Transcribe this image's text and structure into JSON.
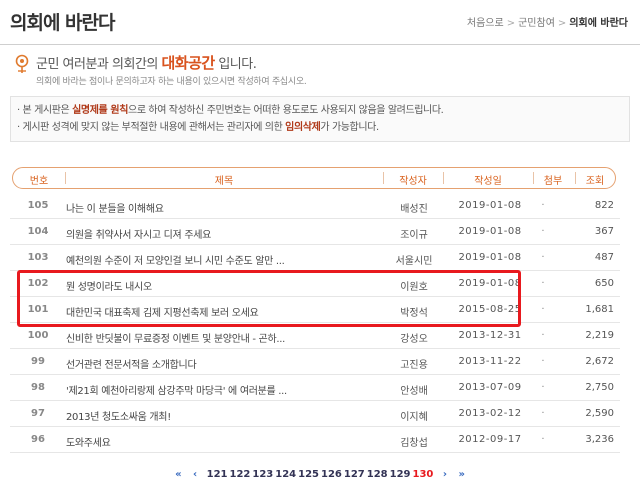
{
  "header": {
    "title": "의회에 바란다",
    "breadcrumb": [
      "처음으로",
      "군민참여",
      "의회에 바란다"
    ],
    "separator": ">"
  },
  "intro": {
    "headline_pre": "군민 여러분과 의회간의 ",
    "headline_highlight": "대화공간",
    "headline_post": " 입니다.",
    "sub": "의회에 바라는 점이나 문의하고자 하는 내용이 있으시면 작성하여 주십시오.",
    "icon": "flower-icon",
    "accent_color": "#d9531e"
  },
  "notice": {
    "line1_pre": "· 본 게시판은 ",
    "line1_bold": "실명제를 원칙",
    "line1_post": "으로 하여 작성하신 주민번호는 어떠한 용도로도 사용되지 않음을 알려드립니다.",
    "line2_pre": "· 게시판 성격에 맞지 않는 부적절한 내용에 관해서는 관리자에 의한 ",
    "line2_bold": "임의삭제",
    "line2_post": "가 가능합니다."
  },
  "table": {
    "columns": [
      "번호",
      "제목",
      "작성자",
      "작성일",
      "첨부",
      "조회"
    ],
    "rows": [
      {
        "no": "105",
        "title": "나는 이 분들을 이해해요",
        "author": "배성진",
        "date": "2019-01-08",
        "attach": "·",
        "views": "822"
      },
      {
        "no": "104",
        "title": "의원을 취약사서 자시고 디져 주세요",
        "author": "조이규",
        "date": "2019-01-08",
        "attach": "·",
        "views": "367"
      },
      {
        "no": "103",
        "title": "예천의원 수준이 저 모양인걸 보니 시민 수준도 알만 ...",
        "author": "서울시민",
        "date": "2019-01-08",
        "attach": "·",
        "views": "487"
      },
      {
        "no": "102",
        "title": "뭔 성명이라도 내시오",
        "author": "이원호",
        "date": "2019-01-08",
        "attach": "·",
        "views": "650"
      },
      {
        "no": "101",
        "title": "대한민국 대표축제 김제 지평선축제 보러 오세요",
        "author": "박정석",
        "date": "2015-08-25",
        "attach": "·",
        "views": "1,681"
      },
      {
        "no": "100",
        "title": "신비한 반딧불이 무료증정 이벤트 및 분양안내 - 곤하...",
        "author": "강성오",
        "date": "2013-12-31",
        "attach": "·",
        "views": "2,219"
      },
      {
        "no": "99",
        "title": "선거관련 전문서적을 소개합니다",
        "author": "고진용",
        "date": "2013-11-22",
        "attach": "·",
        "views": "2,672"
      },
      {
        "no": "98",
        "title": "'제21회 예천아리랑제 삼강주막 마당극' 에 여러분를 ...",
        "author": "안성배",
        "date": "2013-07-09",
        "attach": "·",
        "views": "2,750"
      },
      {
        "no": "97",
        "title": "2013년 청도소싸움 개최!",
        "author": "이지혜",
        "date": "2013-02-12",
        "attach": "·",
        "views": "2,590"
      },
      {
        "no": "96",
        "title": "도와주세요",
        "author": "김창섭",
        "date": "2012-09-17",
        "attach": "·",
        "views": "3,236"
      }
    ]
  },
  "pagination": {
    "first": "«",
    "prev": "‹",
    "pages": [
      "121",
      "122",
      "123",
      "124",
      "125",
      "126",
      "127",
      "128",
      "129",
      "130"
    ],
    "current": "130",
    "next": "›",
    "last": "»"
  },
  "colors": {
    "accent": "#d9621e",
    "highlight_box": "#e8191e",
    "pagination_arrow": "#3a6bbf"
  }
}
